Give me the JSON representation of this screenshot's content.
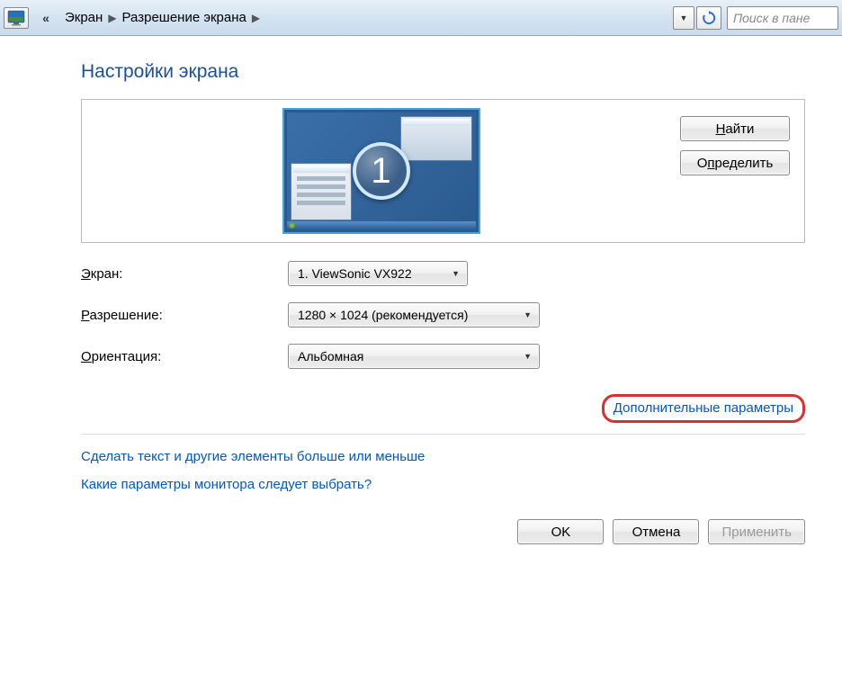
{
  "breadcrumb": {
    "item1": "Экран",
    "item2": "Разрешение экрана"
  },
  "search": {
    "placeholder": "Поиск в пане"
  },
  "page_title": "Настройки экрана",
  "monitor_number": "1",
  "preview_buttons": {
    "find": "Найти",
    "detect": "Определить"
  },
  "settings": {
    "screen_label": "Экран:",
    "screen_value": "1. ViewSonic VX922",
    "resolution_label": "Разрешение:",
    "resolution_value": "1280 × 1024 (рекомендуется)",
    "orientation_label": "Ориентация:",
    "orientation_value": "Альбомная"
  },
  "advanced_link": "Дополнительные параметры",
  "help": {
    "link1": "Сделать текст и другие элементы больше или меньше",
    "link2": "Какие параметры монитора следует выбрать?"
  },
  "dialog_buttons": {
    "ok": "OK",
    "cancel": "Отмена",
    "apply": "Применить"
  }
}
